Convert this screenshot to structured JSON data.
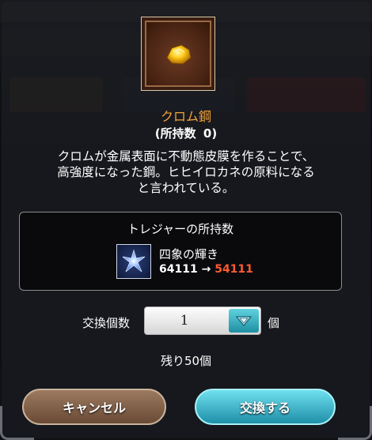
{
  "item": {
    "name": "クロム鋼",
    "owned_label": "(所持数",
    "owned_count": "0)",
    "description_lines": [
      "クロムが金属表面に不動態皮膜を作ることで、",
      "高強度になった鋼。ヒヒイロカネの原料になる",
      "と言われている。"
    ],
    "icon": "gold-nugget-icon"
  },
  "treasure": {
    "title": "トレジャーの所持数",
    "name": "四象の輝き",
    "count_before": "64111",
    "arrow": "→",
    "count_after": "54111",
    "icon": "blue-star-icon"
  },
  "quantity": {
    "label": "交換個数",
    "value": "1",
    "unit": "個",
    "dropdown_icon": "chevron-down-icon"
  },
  "remaining": "残り50個",
  "buttons": {
    "cancel": "キャンセル",
    "confirm": "交換する"
  },
  "colors": {
    "item_name": "#f3a23a",
    "count_after": "#ff5a2e",
    "confirm_button": "#1e8fa8",
    "cancel_button": "#6a4a36"
  }
}
